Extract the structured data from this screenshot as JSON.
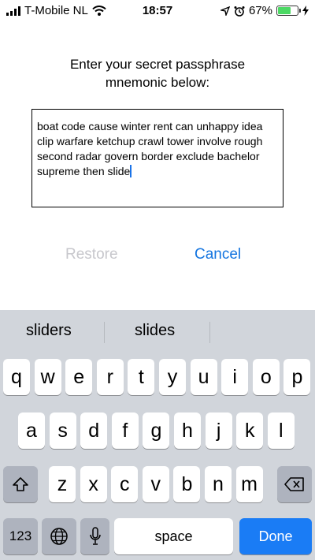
{
  "status_bar": {
    "carrier": "T-Mobile NL",
    "time": "18:57",
    "battery_percent": "67%",
    "battery_level": 0.67,
    "icons": [
      "signal-icon",
      "wifi-icon",
      "location-icon",
      "alarm-icon",
      "battery-icon",
      "charging-icon"
    ]
  },
  "prompt": {
    "line1": "Enter your secret passphrase",
    "line2": "mnemonic below:"
  },
  "mnemonic": {
    "value": "boat code cause winter rent can unhappy idea clip warfare ketchup crawl tower involve rough second radar govern border exclude bachelor supreme then slide"
  },
  "actions": {
    "restore": "Restore",
    "cancel": "Cancel"
  },
  "colors": {
    "accent": "#1475e0",
    "disabled": "#c7c7cc",
    "keyboard_bg": "#d1d5db",
    "done_key": "#1a7cf5"
  },
  "keyboard": {
    "suggestions": [
      "sliders",
      "slides"
    ],
    "row1": [
      "q",
      "w",
      "e",
      "r",
      "t",
      "y",
      "u",
      "i",
      "o",
      "p"
    ],
    "row2": [
      "a",
      "s",
      "d",
      "f",
      "g",
      "h",
      "j",
      "k",
      "l"
    ],
    "row3": [
      "z",
      "x",
      "c",
      "v",
      "b",
      "n",
      "m"
    ],
    "numbers_key": "123",
    "space_key": "space",
    "done_key": "Done"
  }
}
